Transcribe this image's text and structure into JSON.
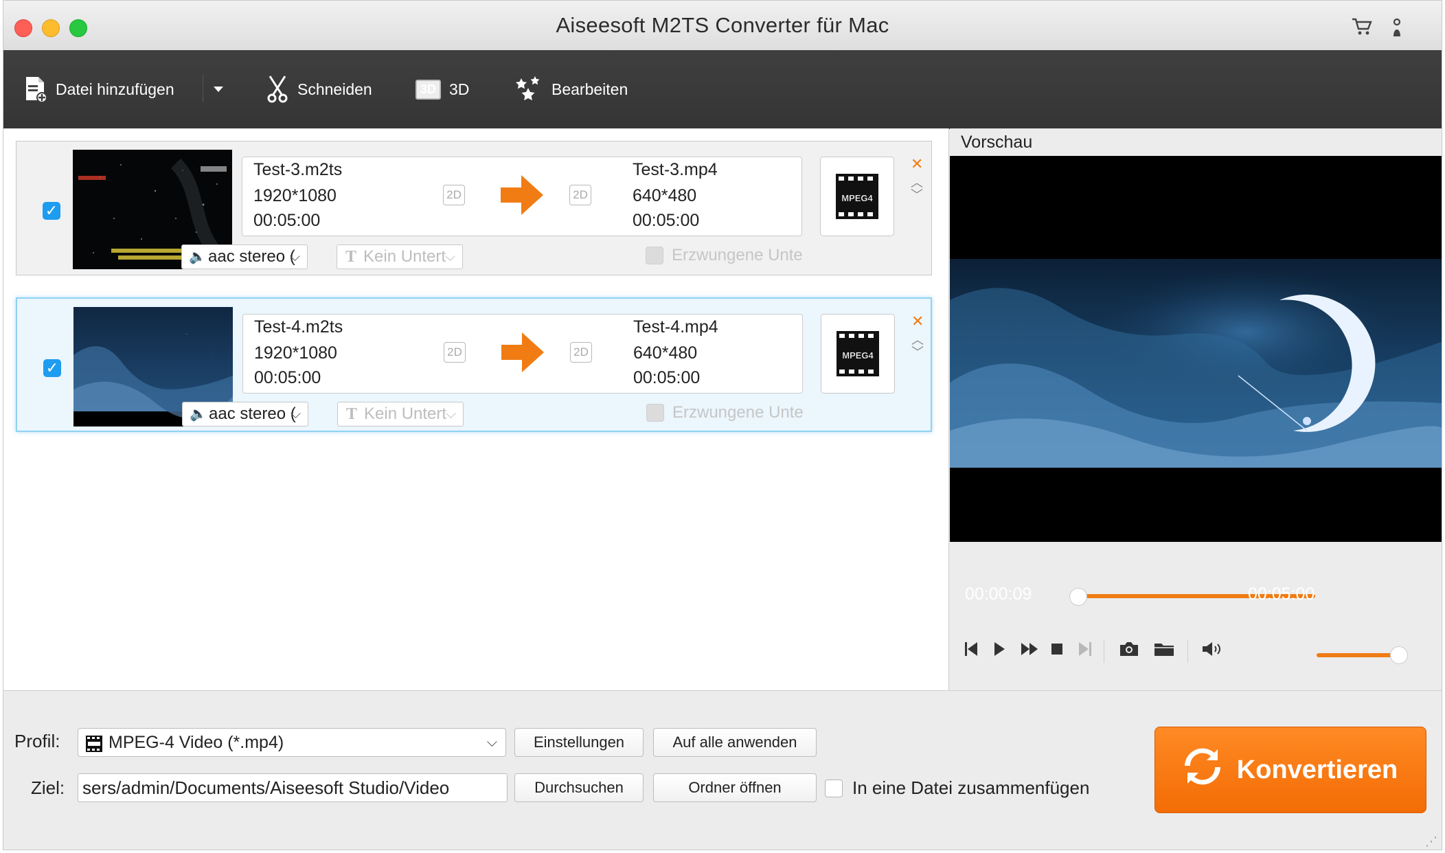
{
  "window": {
    "title": "Aiseesoft M2TS Converter für Mac"
  },
  "titlebar_icons": {
    "cart": "cart-icon",
    "user": "user-icon"
  },
  "toolbar": {
    "add_file": "Datei hinzufügen",
    "cut": "Schneiden",
    "three_d_badge": "3D",
    "three_d": "3D",
    "edit": "Bearbeiten"
  },
  "files": [
    {
      "checked": true,
      "source_name": "Test-3.m2ts",
      "source_resolution": "1920*1080",
      "source_duration": "00:05:00",
      "source_mode": "2D",
      "output_mode": "2D",
      "output_name": "Test-3.mp4",
      "output_resolution": "640*480",
      "output_duration": "00:05:00",
      "format_badge": "MPEG4",
      "audio": "aac stereo (",
      "subtitle": "Kein Untert",
      "forced_subtitle": "Erzwungene Unte"
    },
    {
      "checked": true,
      "source_name": "Test-4.m2ts",
      "source_resolution": "1920*1080",
      "source_duration": "00:05:00",
      "source_mode": "2D",
      "output_mode": "2D",
      "output_name": "Test-4.mp4",
      "output_resolution": "640*480",
      "output_duration": "00:05:00",
      "format_badge": "MPEG4",
      "audio": "aac stereo (",
      "subtitle": "Kein Untert",
      "forced_subtitle": "Erzwungene Unte"
    }
  ],
  "preview": {
    "label": "Vorschau",
    "current_time": "00:00:09",
    "total_time": "00:05:00",
    "progress_fraction": 0.03,
    "volume_fraction": 1.0
  },
  "bottom": {
    "profile_label": "Profil:",
    "profile_value": "MPEG-4 Video (*.mp4)",
    "settings_button": "Einstellungen",
    "apply_all_button": "Auf alle anwenden",
    "target_label": "Ziel:",
    "target_path": "sers/admin/Documents/Aiseesoft Studio/Video",
    "browse_button": "Durchsuchen",
    "open_folder_button": "Ordner öffnen",
    "merge_label": "In eine Datei zusammenfügen",
    "convert_button": "Konvertieren"
  },
  "colors": {
    "accent": "#f07c13",
    "checkbox": "#1e9cf0",
    "toolbar": "#3a3a3a"
  }
}
